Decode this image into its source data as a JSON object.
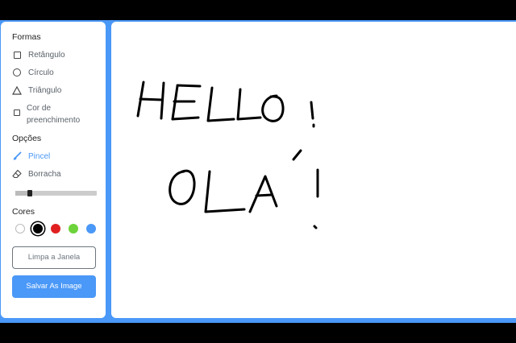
{
  "shapes": {
    "title": "Formas",
    "items": [
      {
        "label": "Retângulo",
        "icon": "rectangle-icon"
      },
      {
        "label": "Círculo",
        "icon": "circle-icon"
      },
      {
        "label": "Triângulo",
        "icon": "triangle-icon"
      }
    ],
    "fill_label": "Cor de preenchimento"
  },
  "options": {
    "title": "Opções",
    "brush_label": "Pincel",
    "eraser_label": "Borracha",
    "brush_size": 0.16
  },
  "colors": {
    "title": "Cores",
    "swatches": [
      "#ffffff",
      "#000000",
      "#E02020",
      "#6DD33A",
      "#4A98F7"
    ],
    "selected_index": 1
  },
  "actions": {
    "clear_label": "Limpa a Janela",
    "save_label": "Salvar As Image"
  },
  "theme": {
    "accent": "#4A98F7"
  }
}
